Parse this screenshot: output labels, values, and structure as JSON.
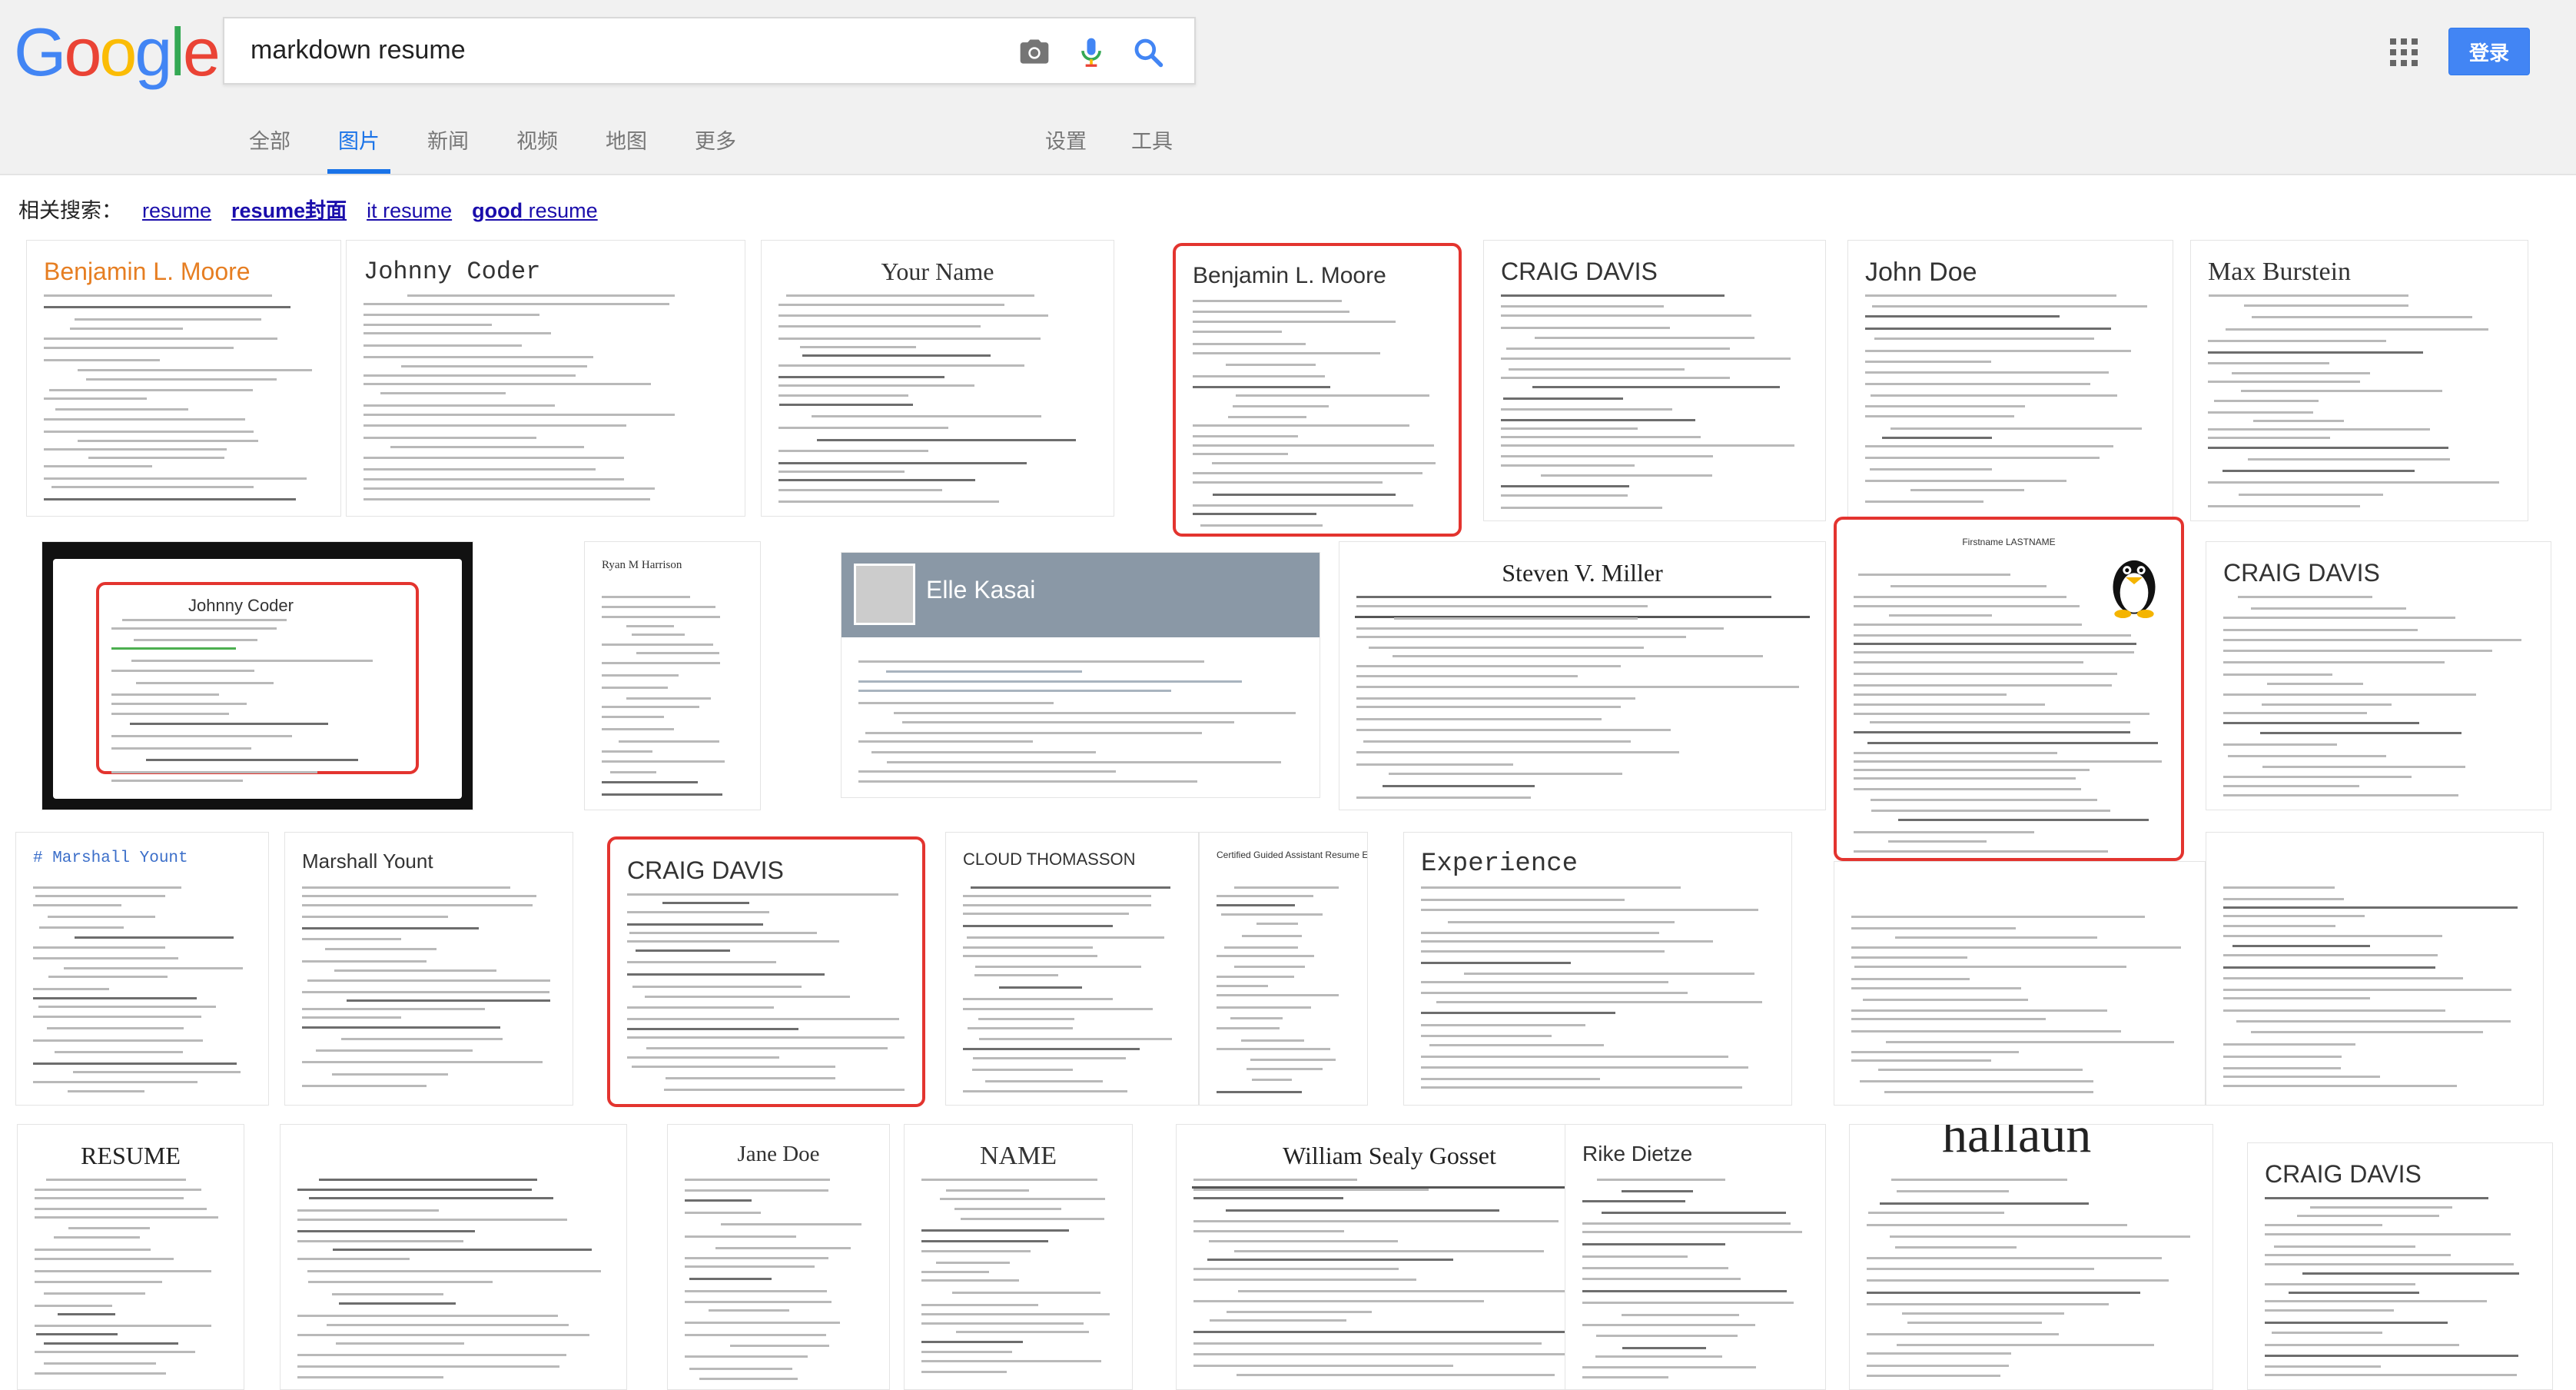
{
  "logo": {
    "text": "Google",
    "letters": [
      {
        "ch": "G",
        "color": "#4285f4"
      },
      {
        "ch": "o",
        "color": "#ea4335"
      },
      {
        "ch": "o",
        "color": "#fbbc05"
      },
      {
        "ch": "g",
        "color": "#4285f4"
      },
      {
        "ch": "l",
        "color": "#34a853"
      },
      {
        "ch": "e",
        "color": "#ea4335"
      }
    ]
  },
  "search": {
    "query": "markdown resume"
  },
  "icons": {
    "camera": "camera-icon",
    "mic": "microphone-icon",
    "search": "search-icon",
    "apps": "apps-grid-icon"
  },
  "header": {
    "login_label": "登录"
  },
  "tabs": [
    {
      "label": "全部",
      "active": false
    },
    {
      "label": "图片",
      "active": true
    },
    {
      "label": "新闻",
      "active": false
    },
    {
      "label": "视频",
      "active": false
    },
    {
      "label": "地图",
      "active": false
    },
    {
      "label": "更多",
      "active": false
    }
  ],
  "tools": {
    "settings": "设置",
    "tools": "工具"
  },
  "related": {
    "prefix": "相关搜索：",
    "items": [
      {
        "text": "resume",
        "bold": ""
      },
      {
        "text": "",
        "bold": "resume封面"
      },
      {
        "text": "it resume",
        "bold": ""
      },
      {
        "text": "",
        "bold": "good",
        "rest": " resume"
      }
    ]
  },
  "colors": {
    "accent": "#1a73e8",
    "login": "#4285f4",
    "selected_outline": "#e3342f",
    "link": "#1a0dab"
  },
  "results": [
    {
      "title": "Benjamin L. Moore",
      "style": "sans",
      "color": "#e67e22"
    },
    {
      "title": "Johnny Coder",
      "style": "mono",
      "color": "#333"
    },
    {
      "title": "Your Name",
      "style": "serif",
      "color": "#333"
    },
    {
      "title": "Benjamin L. Moore",
      "style": "sans",
      "color": "#333",
      "selected": true
    },
    {
      "title": "CRAIG DAVIS",
      "style": "sans",
      "color": "#333"
    },
    {
      "title": "John Doe",
      "style": "sans",
      "color": "#333"
    },
    {
      "title": "Max Burstein",
      "style": "serif",
      "color": "#333"
    },
    {
      "title": "Johnny Coder",
      "style": "sans",
      "color": "#333"
    },
    {
      "title": "Ryan M Harrison",
      "style": "serif",
      "color": "#333"
    },
    {
      "title": "Elle Kasai",
      "style": "sans",
      "color": "#fff"
    },
    {
      "title": "Steven V. Miller",
      "style": "serif",
      "color": "#222"
    },
    {
      "title": "Firstname LASTNAME",
      "style": "sans",
      "color": "#333",
      "selected": true
    },
    {
      "title": "CRAIG DAVIS",
      "style": "sans",
      "color": "#333"
    },
    {
      "title": "# Marshall Yount",
      "style": "mono",
      "color": "#3b6ec9"
    },
    {
      "title": "Marshall Yount",
      "style": "sans",
      "color": "#333"
    },
    {
      "title": "CRAIG DAVIS",
      "style": "sans",
      "color": "#333",
      "selected": true
    },
    {
      "title": "CLOUD THOMASSON",
      "style": "sans",
      "color": "#333"
    },
    {
      "title": "Certified Guided Assistant Resume Example",
      "style": "sans",
      "color": "#333"
    },
    {
      "title": "Experience",
      "style": "mono",
      "color": "#333"
    },
    {
      "title": "",
      "style": "sans",
      "color": "#333"
    },
    {
      "title": "",
      "style": "serif",
      "color": "#333"
    },
    {
      "title": "RESUME",
      "style": "serif",
      "color": "#222"
    },
    {
      "title": "",
      "style": "serif",
      "color": "#333"
    },
    {
      "title": "Jane Doe",
      "style": "serif",
      "color": "#333"
    },
    {
      "title": "NAME",
      "style": "serif",
      "color": "#333"
    },
    {
      "title": "William Sealy Gosset",
      "style": "serif",
      "color": "#222"
    },
    {
      "title": "Rike Dietze",
      "style": "sans",
      "color": "#333"
    },
    {
      "title": "hallaun",
      "style": "serif",
      "color": "#222"
    },
    {
      "title": "CRAIG DAVIS",
      "style": "sans",
      "color": "#333"
    }
  ]
}
